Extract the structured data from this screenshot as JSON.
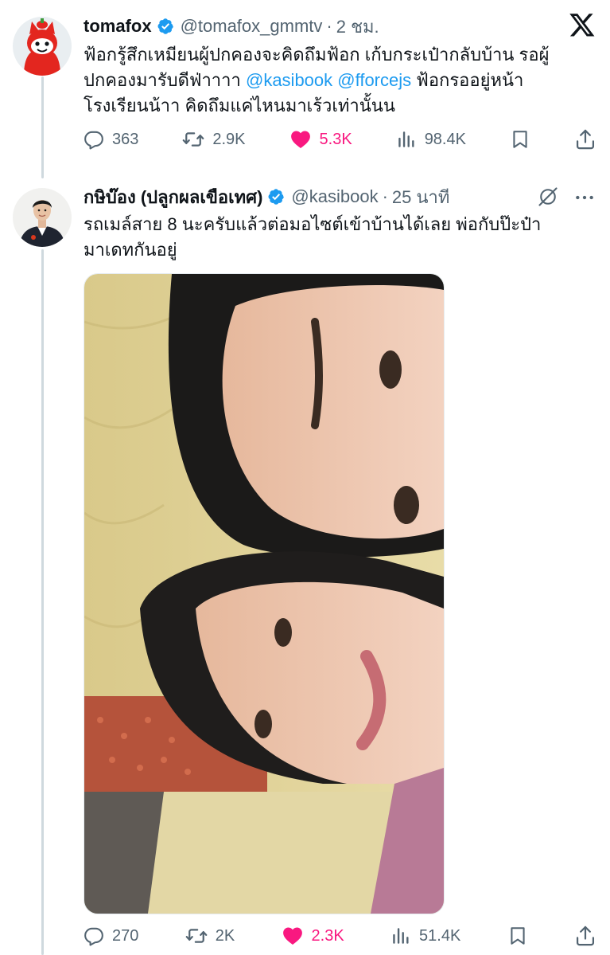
{
  "tweets": [
    {
      "display_name": "tomafox",
      "handle": "@tomafox_gmmtv",
      "dot": "·",
      "time": "2 ชม.",
      "text_lines": [
        [
          {
            "t": "ฟ้อกรู้สึกเหมียนผู้ปกคองจะคิดถึมฟ้อก เก้บกระเป๋ากลับบ้าน รอผู้",
            "m": false
          }
        ],
        [
          {
            "t": "ปกคองมารับดีฟ่าาาา ",
            "m": false
          },
          {
            "t": "@kasibook",
            "m": true
          },
          {
            "t": " ",
            "m": false
          },
          {
            "t": "@fforcejs",
            "m": true
          },
          {
            "t": " ฟ้อกรออยู่หน้า",
            "m": false
          }
        ],
        [
          {
            "t": "โรงเรียนน้าา คิดถึมแค่ไหนมาเร้วเท่านั้นน",
            "m": false
          }
        ]
      ],
      "replies": "363",
      "reposts": "2.9K",
      "likes": "5.3K",
      "views": "98.4K",
      "avatar_icon": "red-fox-mascot-avatar",
      "verified_icon": "verified-badge-icon"
    },
    {
      "display_name": "กษิบ๊อง (ปลูกผลเขือเทศ)",
      "handle": "@kasibook",
      "dot": "·",
      "time": "25 นาที",
      "text_lines": [
        [
          {
            "t": "รถเมล์สาย 8 นะครับแล้วต่อมอไซต์เข้าบ้านได้เลย พ่อกับป๊ะป๋า",
            "m": false
          }
        ],
        [
          {
            "t": "มาเดทกันอยู่",
            "m": false
          }
        ]
      ],
      "replies": "270",
      "reposts": "2K",
      "likes": "2.3K",
      "views": "51.4K",
      "avatar_icon": "man-portrait-avatar",
      "verified_icon": "verified-badge-icon",
      "media": "selfie-photo-two-people"
    }
  ],
  "colors": {
    "text": "#0f1419",
    "secondary": "#536471",
    "mention": "#1d9bf0",
    "verified": "#1d9bf0",
    "like": "#f91880",
    "thread_line": "#cfd9de"
  },
  "icons": {
    "platform_logo": "x-logo-icon",
    "reply": "reply-icon",
    "repost": "repost-icon",
    "like": "heart-icon",
    "views": "views-icon",
    "bookmark": "bookmark-icon",
    "share": "share-icon",
    "grok": "grok-icon",
    "more": "more-icon"
  }
}
